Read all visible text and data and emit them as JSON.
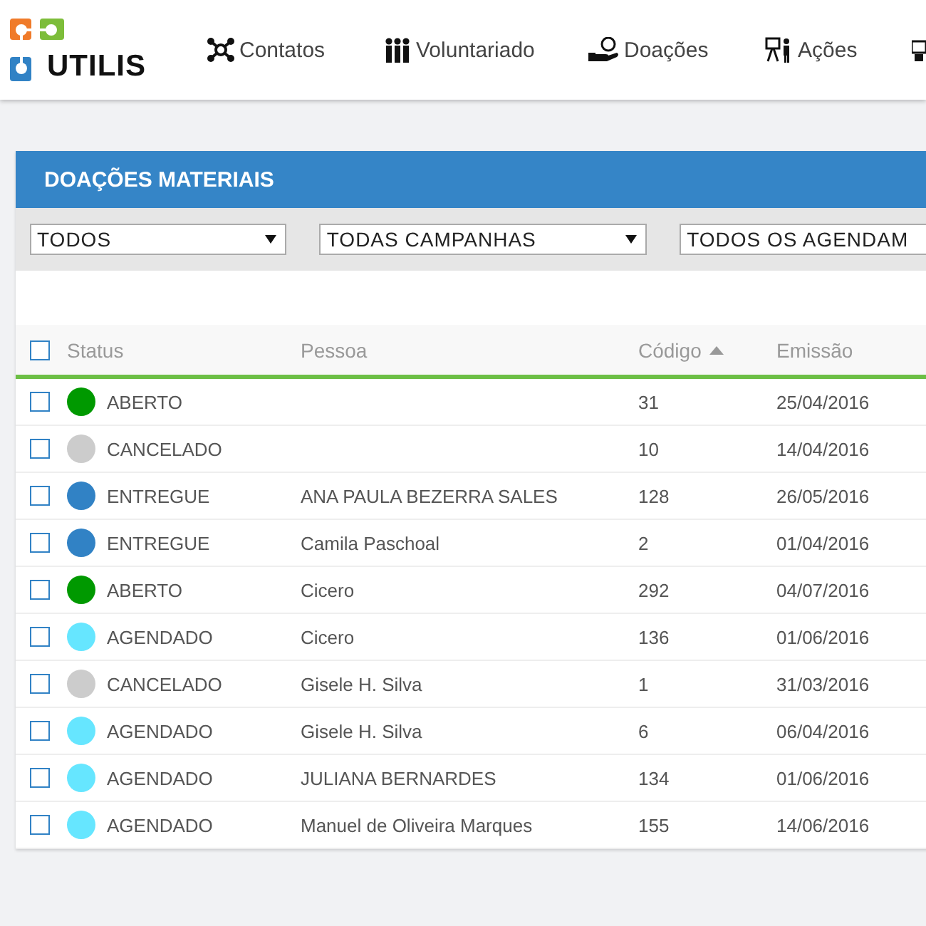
{
  "logo": {
    "text": "UTILIS"
  },
  "nav": [
    {
      "kind": "network",
      "label": "Contatos"
    },
    {
      "kind": "people",
      "label": "Voluntariado"
    },
    {
      "kind": "donation",
      "label": "Doações"
    },
    {
      "kind": "presenter",
      "label": "Ações"
    },
    {
      "kind": "partial"
    }
  ],
  "panel": {
    "title": "DOAÇÕES MATERIAIS",
    "filters": [
      {
        "value": "TODOS"
      },
      {
        "value": "TODAS CAMPANHAS"
      },
      {
        "value": "TODOS OS AGENDAM"
      }
    ],
    "table": {
      "select_all": {
        "checked": false
      },
      "columns": [
        {
          "label": "Status",
          "sorted": false
        },
        {
          "label": "Pessoa",
          "sorted": false
        },
        {
          "label": "Código",
          "sorted": true
        },
        {
          "label": "Emissão",
          "sorted": false
        }
      ],
      "rows": [
        {
          "checked": false,
          "color": "#009900",
          "status": "ABERTO",
          "pessoa": "",
          "codigo": "31",
          "emissao": "25/04/2016"
        },
        {
          "checked": false,
          "color": "#cccccc",
          "status": "CANCELADO",
          "pessoa": "",
          "codigo": "10",
          "emissao": "14/04/2016"
        },
        {
          "checked": false,
          "color": "#3182c5",
          "status": "ENTREGUE",
          "pessoa": "ANA PAULA BEZERRA SALES",
          "codigo": "128",
          "emissao": "26/05/2016"
        },
        {
          "checked": false,
          "color": "#3182c5",
          "status": "ENTREGUE",
          "pessoa": "Camila Paschoal",
          "codigo": "2",
          "emissao": "01/04/2016"
        },
        {
          "checked": false,
          "color": "#009900",
          "status": "ABERTO",
          "pessoa": "Cicero",
          "codigo": "292",
          "emissao": "04/07/2016"
        },
        {
          "checked": false,
          "color": "#66e6ff",
          "status": "AGENDADO",
          "pessoa": "Cicero",
          "codigo": "136",
          "emissao": "01/06/2016"
        },
        {
          "checked": false,
          "color": "#cccccc",
          "status": "CANCELADO",
          "pessoa": "Gisele H. Silva",
          "codigo": "1",
          "emissao": "31/03/2016"
        },
        {
          "checked": false,
          "color": "#66e6ff",
          "status": "AGENDADO",
          "pessoa": "Gisele H. Silva",
          "codigo": "6",
          "emissao": "06/04/2016"
        },
        {
          "checked": false,
          "color": "#66e6ff",
          "status": "AGENDADO",
          "pessoa": "JULIANA BERNARDES",
          "codigo": "134",
          "emissao": "01/06/2016"
        },
        {
          "checked": false,
          "color": "#66e6ff",
          "status": "AGENDADO",
          "pessoa": "Manuel de Oliveira Marques",
          "codigo": "155",
          "emissao": "14/06/2016"
        }
      ]
    }
  }
}
